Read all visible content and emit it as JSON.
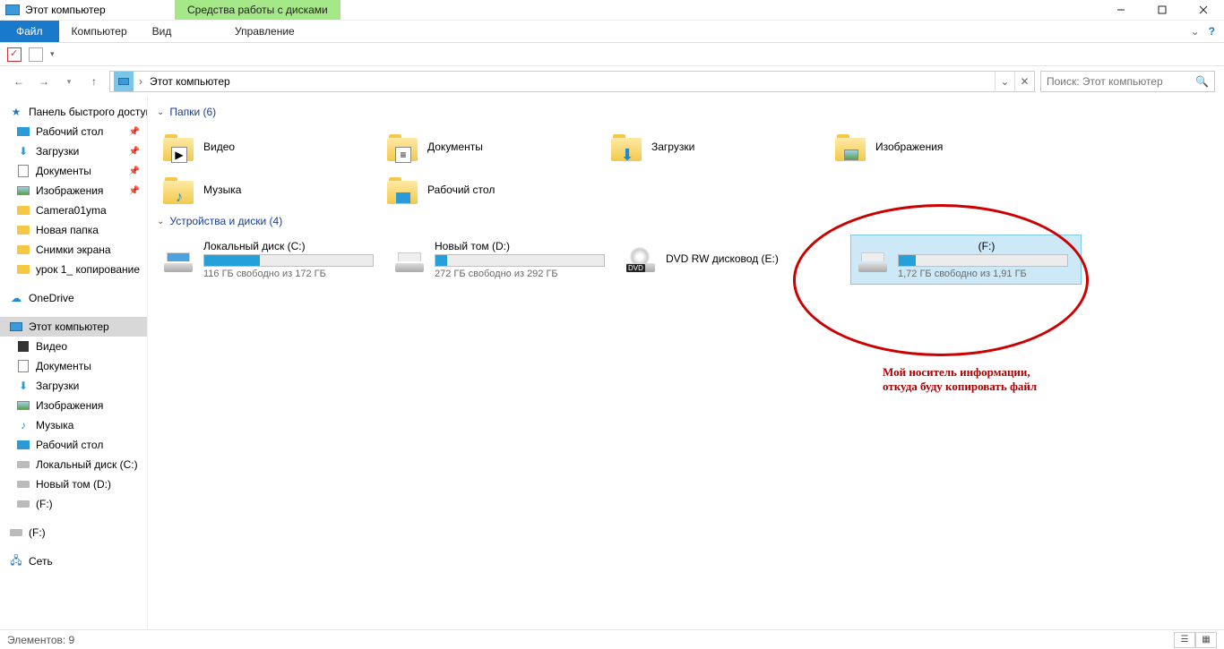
{
  "title": "Этот компьютер",
  "ribbonContext": "Средства работы с дисками",
  "menu": {
    "file": "Файл",
    "computer": "Компьютер",
    "view": "Вид",
    "manage": "Управление"
  },
  "breadcrumb": {
    "location": "Этот компьютер"
  },
  "search": {
    "placeholder": "Поиск: Этот компьютер"
  },
  "sidebar": {
    "quick": "Панель быстрого доступа",
    "pinned": [
      {
        "label": "Рабочий стол"
      },
      {
        "label": "Загрузки"
      },
      {
        "label": "Документы"
      },
      {
        "label": "Изображения"
      }
    ],
    "recent": [
      {
        "label": "Camera01yma"
      },
      {
        "label": "Новая папка"
      },
      {
        "label": "Снимки экрана"
      },
      {
        "label": "урок 1_ копирование"
      }
    ],
    "onedrive": "OneDrive",
    "thispc": "Этот компьютер",
    "libs": [
      {
        "label": "Видео"
      },
      {
        "label": "Документы"
      },
      {
        "label": "Загрузки"
      },
      {
        "label": "Изображения"
      },
      {
        "label": "Музыка"
      },
      {
        "label": "Рабочий стол"
      }
    ],
    "drives": [
      {
        "label": "Локальный диск (C:)"
      },
      {
        "label": "Новый том (D:)"
      },
      {
        "label": "(F:)"
      }
    ],
    "extra": [
      {
        "label": "(F:)"
      }
    ],
    "network": "Сеть"
  },
  "groups": {
    "folders": "Папки (6)",
    "devices": "Устройства и диски (4)"
  },
  "folders": [
    {
      "label": "Видео"
    },
    {
      "label": "Документы"
    },
    {
      "label": "Загрузки"
    },
    {
      "label": "Изображения"
    },
    {
      "label": "Музыка"
    },
    {
      "label": "Рабочий стол"
    }
  ],
  "drives": [
    {
      "name": "Локальный диск (C:)",
      "sub": "116 ГБ свободно из 172 ГБ",
      "fill": 33
    },
    {
      "name": "Новый том (D:)",
      "sub": "272 ГБ свободно из 292 ГБ",
      "fill": 7
    },
    {
      "name": "DVD RW дисковод (E:)",
      "sub": "",
      "fill": -1
    },
    {
      "name": "(F:)",
      "sub": "1,72 ГБ свободно из 1,91 ГБ",
      "fill": 10,
      "selected": true
    }
  ],
  "annotation": "Мой носитель информации, откуда буду копировать файл",
  "status": "Элементов: 9"
}
